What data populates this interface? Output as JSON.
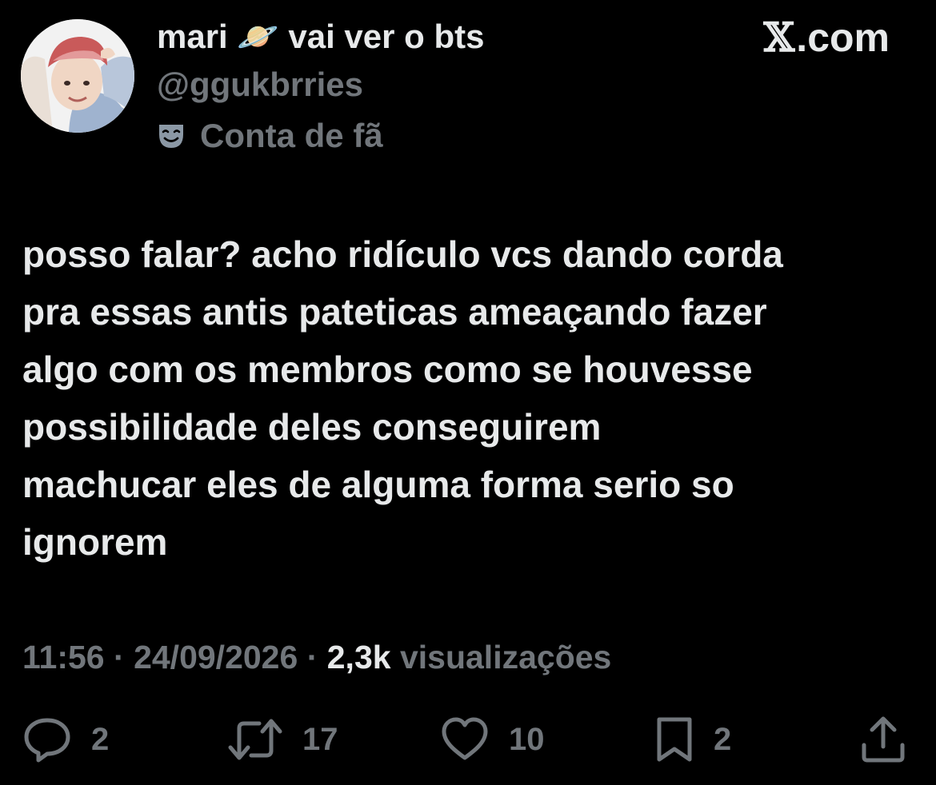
{
  "author": {
    "display_name": "mari ⁠🪐 vai ver o bts",
    "handle": "@ggukbrries",
    "label": "Conta de fã",
    "label_icon": "theater-mask-icon"
  },
  "brand": {
    "text": ".com",
    "mark": "𝕏"
  },
  "tweet": {
    "lines": [
      "posso falar? acho ridículo vcs dando corda",
      "pra essas antis pateticas ameaçando fazer",
      "algo com os membros como se houvesse",
      "possibilidade deles conseguirem",
      "machucar eles de alguma forma serio so",
      "ignorem"
    ]
  },
  "meta": {
    "time": "11:56",
    "separator": "·",
    "date": "24/09/2026",
    "views_count": "2,3k",
    "views_label": "visualizações"
  },
  "actions": {
    "replies": "2",
    "reposts": "17",
    "likes": "10",
    "bookmarks": "2"
  },
  "colors": {
    "background": "#000000",
    "primary_text": "#e7e9ea",
    "secondary_text": "#71767b"
  }
}
